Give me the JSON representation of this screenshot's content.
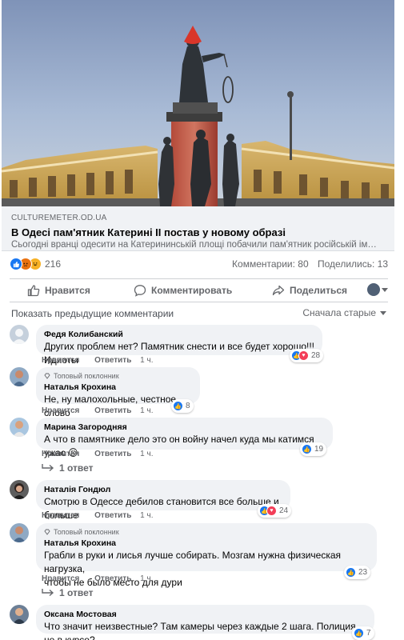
{
  "post": {
    "image_alt": "Памятник Екатерине II в Одессе",
    "link": {
      "domain": "CULTUREMETER.OD.UA",
      "title": "В Одесі пам'ятник Катерині ІІ постав у новому образі",
      "description": "Сьогодні вранці одесити на Катерининській площі побачили пам'ятник російській імператриці"
    },
    "reactions": {
      "count": "216",
      "types": [
        "like",
        "angry",
        "haha"
      ]
    },
    "comments_count": "Комментарии: 80",
    "shares_count": "Поделились: 13",
    "actions": {
      "like": "Нравится",
      "comment": "Комментировать",
      "share": "Поделиться"
    }
  },
  "comments_header": {
    "previous": "Показать предыдущие комментарии",
    "sort": "Сначала старые"
  },
  "comment_labels": {
    "like": "Нравится",
    "reply": "Ответить",
    "badge": "Топовый поклонник"
  },
  "comments": [
    {
      "author": "Федя Колибанский",
      "text": "Других проблем нет? Памятник снести и все будет хорошо!!! Идиоты",
      "time": "1 ч.",
      "reactions": "28",
      "reaction_types": [
        "like",
        "heart"
      ],
      "top_fan": false
    },
    {
      "author": "Наталья Крохина",
      "text": "Не, ну малохольные, честное слово",
      "time": "1 ч.",
      "reactions": "8",
      "reaction_types": [
        "like"
      ],
      "top_fan": true
    },
    {
      "author": "Марина Загородняя",
      "text": "А что в памятнике дело это он войну начел куда мы катимся ужас 😥",
      "time": "1 ч.",
      "reactions": "19",
      "reaction_types": [
        "like"
      ],
      "top_fan": false,
      "replies": "1 ответ"
    },
    {
      "author": "Наталія Гондюл",
      "text": "Смотрю в Одессе дебилов становится все больше и больше",
      "time": "1 ч.",
      "reactions": "24",
      "reaction_types": [
        "like",
        "heart"
      ],
      "top_fan": false
    },
    {
      "author": "Наталья Крохина",
      "text_line1": "Грабли в руки и лисья лучше собирать. Мозгам нужна физическая нагрузка,",
      "text_line2": "чтобы не было место для дури",
      "time": "1 ч.",
      "reactions": "23",
      "reaction_types": [
        "like"
      ],
      "top_fan": true,
      "replies": "1 ответ"
    },
    {
      "author": "Оксана Мостовая",
      "text": "Что значит неизвестные? Там камеры через каждые 2 шага. Полиция не в курсе?",
      "reactions": "7",
      "reaction_types": [
        "like"
      ],
      "top_fan": false
    }
  ],
  "colors": {
    "facebook_blue": "#1877f2",
    "secondary_text": "#65676b",
    "bubble_bg": "#f0f2f5"
  }
}
